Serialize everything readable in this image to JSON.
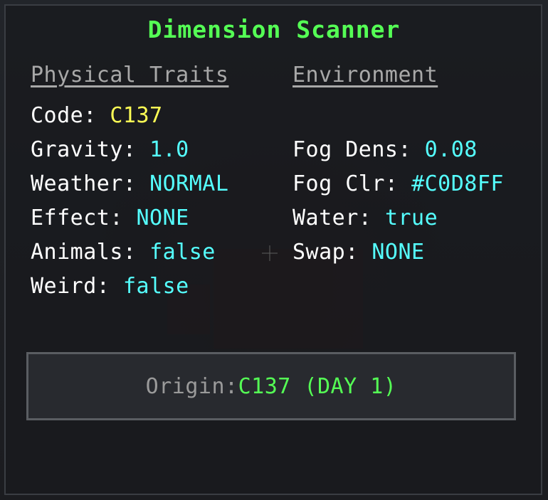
{
  "title": "Dimension Scanner",
  "headings": {
    "physical": "Physical Traits",
    "environment": "Environment"
  },
  "physical": {
    "code": {
      "label": "Code: ",
      "value": "C137"
    },
    "gravity": {
      "label": "Gravity: ",
      "value": "1.0"
    },
    "weather": {
      "label": "Weather: ",
      "value": "NORMAL"
    },
    "effect": {
      "label": "Effect: ",
      "value": "NONE"
    },
    "animals": {
      "label": "Animals: ",
      "value": "false"
    },
    "weird": {
      "label": "Weird: ",
      "value": "false"
    }
  },
  "environment": {
    "fog_dens": {
      "label": "Fog Dens: ",
      "value": "0.08"
    },
    "fog_clr": {
      "label": "Fog Clr: ",
      "value": "#C0D8FF"
    },
    "water": {
      "label": "Water: ",
      "value": "true"
    },
    "swap": {
      "label": "Swap: ",
      "value": "NONE"
    }
  },
  "origin": {
    "label": "Origin: ",
    "value": "C137 (DAY 1)"
  },
  "colors": {
    "title": "#55ff55",
    "value": "#55ffff",
    "code_value": "#ffff55",
    "heading": "#a8a8a8",
    "origin_value": "#55ff55"
  },
  "icons": {
    "crosshair": "crosshair-icon"
  }
}
